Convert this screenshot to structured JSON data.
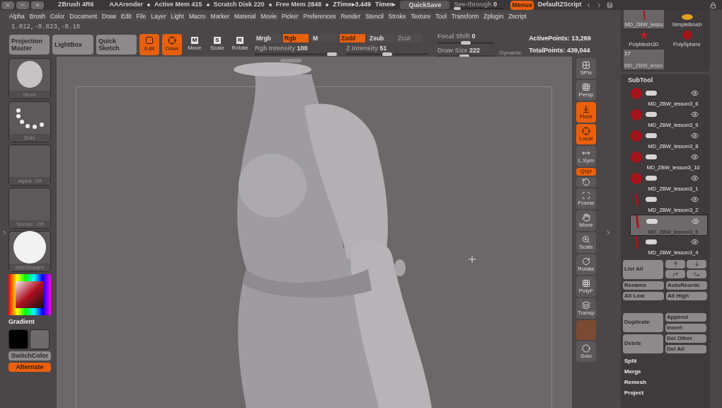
{
  "title_bar": {
    "app_title": "ZBrush 4R6",
    "render": "AAArender",
    "stats": [
      "Active Mem 415",
      "Scratch Disk 220",
      "Free Mem 2848"
    ],
    "ztime": "ZTime▸3.449",
    "timer": "Timer▸",
    "quicksave": "QuickSave",
    "see_through": {
      "label": "See-through",
      "value": "0",
      "level": 0
    },
    "menus": {
      "label": "Menus",
      "on": true
    },
    "script": "DefaultZScript"
  },
  "menu": [
    "Alpha",
    "Brush",
    "Color",
    "Document",
    "Draw",
    "Edit",
    "File",
    "Layer",
    "Light",
    "Macro",
    "Marker",
    "Material",
    "Movie",
    "Picker",
    "Preferences",
    "Render",
    "Stencil",
    "Stroke",
    "Texture",
    "Tool",
    "Transform",
    "Zplugin",
    "Zscript"
  ],
  "coords": "1.012,-0.823,-0.18",
  "toolbar": {
    "buttons": [
      "Projection Master",
      "LightBox",
      "Quick Sketch"
    ],
    "transform": [
      {
        "label": "Edit",
        "kind": "edit",
        "on": true
      },
      {
        "label": "Draw",
        "kind": "draw",
        "on": true
      },
      {
        "label": "Move",
        "key": "M",
        "kind": "key",
        "on": false
      },
      {
        "label": "Scale",
        "key": "S",
        "kind": "key",
        "on": false
      },
      {
        "label": "Rotate",
        "key": "R",
        "kind": "key",
        "on": false
      }
    ],
    "color_modes": [
      {
        "label": "Mrgb",
        "on": false
      },
      {
        "label": "Rgb",
        "on": true
      },
      {
        "label": "M",
        "on": false
      }
    ],
    "depth_modes": [
      {
        "label": "Zadd",
        "on": true,
        "disabled": false
      },
      {
        "label": "Zsub",
        "on": false,
        "disabled": false
      },
      {
        "label": "Zcut",
        "on": false,
        "disabled": true
      }
    ],
    "sliders": [
      {
        "label": "Rgb Intensity",
        "value": "100",
        "level": 0.95
      },
      {
        "label": "Z Intensity",
        "value": "51",
        "level": 0.5
      }
    ],
    "brush_sliders": [
      {
        "label": "Focal Shift",
        "value": "0",
        "level": 0.5
      },
      {
        "label": "Draw Size",
        "value": "222",
        "level": 0.48
      }
    ],
    "dynamic": "Dynamic",
    "points": [
      "ActivePoints: 13,269",
      "TotalPoints: 439,044"
    ]
  },
  "left_shelf": {
    "items": [
      {
        "label": "Move",
        "kind": "brush"
      },
      {
        "label": "Dots",
        "kind": "stroke"
      },
      {
        "label": "Alpha  Off",
        "kind": "blank"
      },
      {
        "label": "Texture  Off",
        "kind": "blank"
      },
      {
        "label": "SkinShade4",
        "kind": "material"
      }
    ],
    "gradient": "Gradient",
    "swatches": [
      {
        "color": "#000000"
      },
      {
        "color": "#6e6b6c"
      }
    ],
    "switch_color": "SwitchColor",
    "alternate": {
      "label": "Alternate",
      "on": true
    }
  },
  "right_shelf": [
    {
      "label": "SPix",
      "kind": "spix",
      "on": false
    },
    {
      "label": "Persp",
      "kind": "persp",
      "on": false
    },
    {
      "label": "Floor",
      "kind": "floor",
      "on": true
    },
    {
      "label": "Local",
      "kind": "local",
      "on": true
    },
    {
      "label": "L.Sym",
      "kind": "lsym",
      "on": false
    },
    {
      "label": "Qxyz",
      "kind": "small",
      "on": true
    },
    {
      "kind": "rotate",
      "on": false
    },
    {
      "label": "Frame",
      "kind": "frame",
      "on": false
    },
    {
      "label": "Move",
      "kind": "move",
      "on": false
    },
    {
      "label": "Scale",
      "kind": "scale",
      "on": false
    },
    {
      "label": "Rotate",
      "kind": "rotate3d",
      "on": false
    },
    {
      "label": "PolyF",
      "kind": "polyf",
      "on": false
    },
    {
      "label": "Transp",
      "kind": "transp",
      "on": false
    },
    {
      "kind": "swatch"
    },
    {
      "label": "Solo",
      "kind": "solo",
      "on": false
    }
  ],
  "tools": [
    {
      "label": "MD_ZBW_lesso",
      "kind": "stick"
    },
    {
      "label": "SimpleBrush",
      "kind": "brush"
    },
    {
      "label": "PolyMesh3D",
      "kind": "star"
    },
    {
      "label": "PolySphere",
      "kind": "sphere"
    }
  ],
  "current_tool": {
    "badge": "17",
    "label": "MD_ZBW_lesso"
  },
  "subtool": {
    "title": "SubTool",
    "items": [
      {
        "name": "MD_ZBW_lesson3_6",
        "kind": "sphere",
        "selected": false
      },
      {
        "name": "MD_ZBW_lesson3_9",
        "kind": "sphere",
        "selected": false
      },
      {
        "name": "MD_ZBW_lesson3_8",
        "kind": "sphere",
        "selected": false
      },
      {
        "name": "MD_ZBW_lesson3_10",
        "kind": "sphere",
        "selected": false
      },
      {
        "name": "MD_ZBW_lesson3_1",
        "kind": "sphere",
        "selected": false
      },
      {
        "name": "MD_ZBW_lesson3_2",
        "kind": "stick",
        "selected": false
      },
      {
        "name": "MD_ZBW_lesson3_5",
        "kind": "stick",
        "selected": true
      },
      {
        "name": "MD_ZBW_lesson3_4",
        "kind": "stick",
        "selected": false
      }
    ],
    "list_all": "List All",
    "row_buttons": [
      [
        "Rename",
        "AutoReorde"
      ],
      [
        "All Low",
        "All High"
      ]
    ],
    "duplicate": "Duplicate",
    "delete": "Delete",
    "dup_side": [
      "Append",
      "Insert"
    ],
    "del_side": [
      "Del Other",
      "Del All"
    ],
    "sections": [
      "Split",
      "Merge",
      "Remesh",
      "Project"
    ]
  }
}
